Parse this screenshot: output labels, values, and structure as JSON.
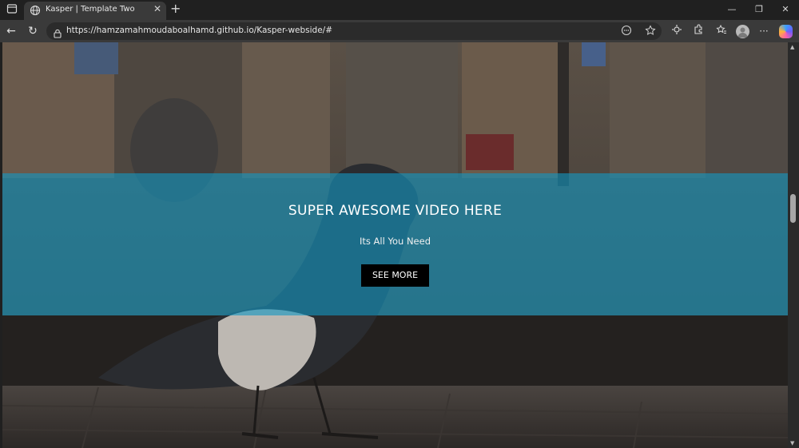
{
  "browser": {
    "tab": {
      "title": "Kasper | Template Two",
      "close_glyph": "✕"
    },
    "new_tab_glyph": "+",
    "window_controls": {
      "minimize": "—",
      "restore": "❐",
      "close": "✕"
    },
    "nav": {
      "back": "←",
      "reload": "↻"
    },
    "address": {
      "url": "https://hamzamahmoudaboalhamd.github.io/Kasper-webside/#"
    },
    "icons": [
      "tab-actions-icon",
      "globe-icon",
      "lock-icon",
      "read-aloud-icon",
      "favorite-star-icon",
      "copilot-extension-icon",
      "extensions-icon",
      "favorites-icon",
      "profile-avatar",
      "more-icon",
      "copilot-icon"
    ],
    "more_glyph": "···"
  },
  "hero": {
    "title": "SUPER AWESOME VIDEO HERE",
    "subtitle": "Its All You Need",
    "button_label": "SEE MORE"
  },
  "colors": {
    "overlay": "#1496c0",
    "button_bg": "#000000",
    "chrome_dark": "#202020",
    "chrome_tab": "#3a3a3a"
  }
}
